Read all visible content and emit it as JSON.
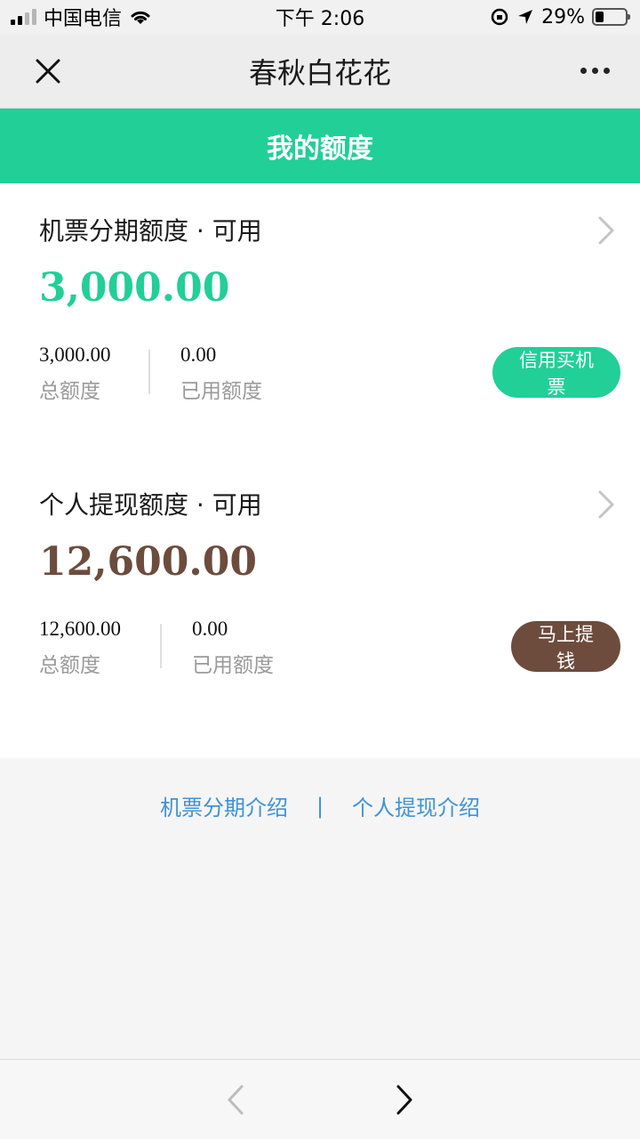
{
  "status_bar": {
    "carrier": "中国电信",
    "time": "下午 2:06",
    "battery_percent": "29%",
    "battery_level": 0.29
  },
  "nav": {
    "title": "春秋白花花"
  },
  "header": {
    "title": "我的额度"
  },
  "cards": [
    {
      "title": "机票分期额度 · 可用",
      "available": "3,000.00",
      "total_value": "3,000.00",
      "total_label": "总额度",
      "used_value": "0.00",
      "used_label": "已用额度",
      "action_label": "信用买机票",
      "accent_color": "#22cf96"
    },
    {
      "title": "个人提现额度 · 可用",
      "available": "12,600.00",
      "total_value": "12,600.00",
      "total_label": "总额度",
      "used_value": "0.00",
      "used_label": "已用额度",
      "action_label": "马上提钱",
      "accent_color": "#6d4c3d"
    }
  ],
  "links": {
    "left": "机票分期介绍",
    "separator": "|",
    "right": "个人提现介绍"
  },
  "icons": {
    "close": "close-icon",
    "more": "more-icon",
    "chevron": "chevron-right-icon",
    "back": "back-arrow-icon",
    "forward": "forward-arrow-icon"
  }
}
